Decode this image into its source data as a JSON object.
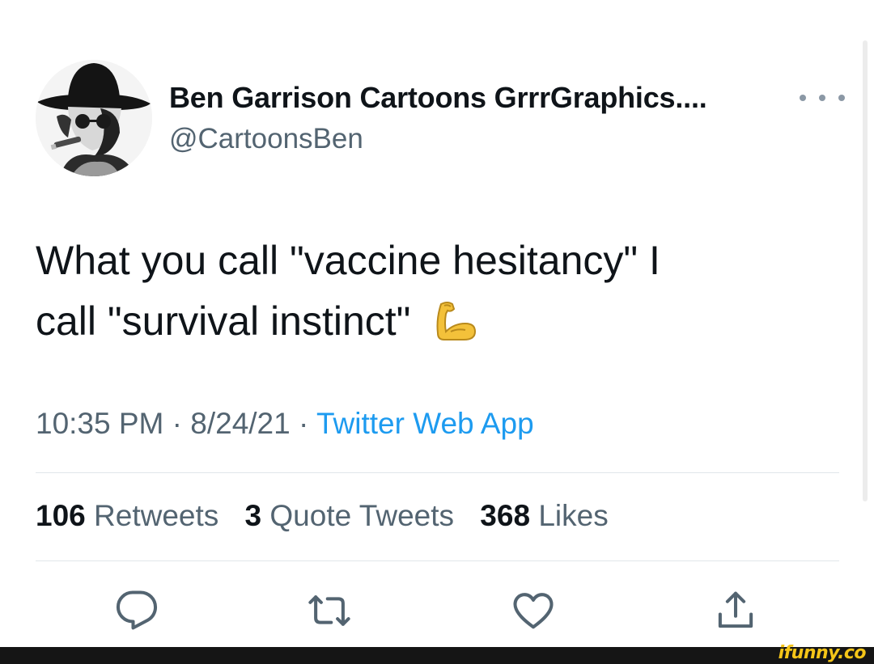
{
  "author": {
    "display_name": "Ben Garrison Cartoons GrrrGraphics....",
    "handle": "@CartoonsBen",
    "avatar_icon": "cowboy-hat-portrait"
  },
  "tweet": {
    "line1": "What you call \"vaccine hesitancy\" I",
    "line2": "call \"survival instinct\"",
    "emoji_icon": "flexed-biceps-emoji"
  },
  "meta": {
    "time": "10:35 PM",
    "separator": "·",
    "date": "8/24/21",
    "source": "Twitter Web App"
  },
  "stats": {
    "retweets_count": "106",
    "retweets_label": "Retweets",
    "quotes_count": "3",
    "quotes_label": "Quote Tweets",
    "likes_count": "368",
    "likes_label": "Likes"
  },
  "actions": {
    "reply_icon": "reply-icon",
    "retweet_icon": "retweet-icon",
    "like_icon": "heart-icon",
    "share_icon": "share-icon"
  },
  "watermark": {
    "text": "ifunny.co",
    "color": "#f5c518"
  },
  "colors": {
    "text": "#0f1419",
    "secondary": "#536471",
    "link": "#1d9bf0",
    "icon": "#536471"
  }
}
